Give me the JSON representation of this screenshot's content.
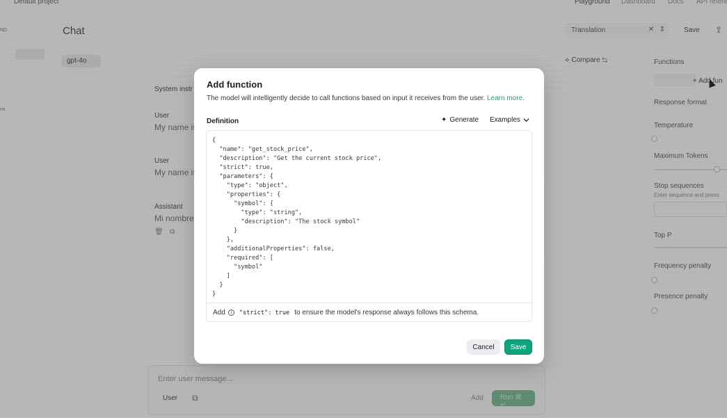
{
  "topbar": {
    "project": "Default project",
    "nav": [
      "Playground",
      "Dashboard",
      "Docs",
      "API refere"
    ]
  },
  "sidebar": {
    "label_a": "ND",
    "label_b": "ns"
  },
  "chat": {
    "title": "Chat",
    "model": "gpt-4o",
    "compare_label": "Compare",
    "preset_name": "Translation",
    "save_label": "Save",
    "system_label": "System instr",
    "messages": [
      {
        "role": "User",
        "text": "My name is"
      },
      {
        "role": "User",
        "text": "My name is"
      },
      {
        "role": "Assistant",
        "text": "Mi nombre"
      }
    ],
    "composer_placeholder": "Enter user message...",
    "composer_role": "User",
    "composer_add": "Add",
    "run_label": "Run ⌘ ↵"
  },
  "right_panel": {
    "functions_label": "Functions",
    "add_function_label": "+ Add fun",
    "response_format_label": "Response format",
    "temperature_label": "Temperature",
    "max_tokens_label": "Maximum Tokens",
    "stop_sequences_label": "Stop sequences",
    "stop_sequences_hint": "Enter sequence and press",
    "top_p_label": "Top P",
    "frequency_penalty_label": "Frequency penalty",
    "presence_penalty_label": "Presence penalty"
  },
  "modal": {
    "title": "Add function",
    "subtitle": "The model will intelligently decide to call functions based on input it receives from the user.",
    "learn_more": "Learn more.",
    "definition_label": "Definition",
    "generate_label": "Generate",
    "examples_label": "Examples",
    "code": "{\n  \"name\": \"get_stock_price\",\n  \"description\": \"Get the current stock price\",\n  \"strict\": true,\n  \"parameters\": {\n    \"type\": \"object\",\n    \"properties\": {\n      \"symbol\": {\n        \"type\": \"string\",\n        \"description\": \"The stock symbol\"\n      }\n    },\n    \"additionalProperties\": false,\n    \"required\": [\n      \"symbol\"\n    ]\n  }\n}",
    "hint_prefix": "Add",
    "hint_code": "\"strict\": true",
    "hint_suffix": "to ensure the model's response always follows this schema.",
    "cancel_label": "Cancel",
    "save_label": "Save"
  },
  "colors": {
    "accent": "#10a37f",
    "overlay": "#b9b9b9"
  }
}
